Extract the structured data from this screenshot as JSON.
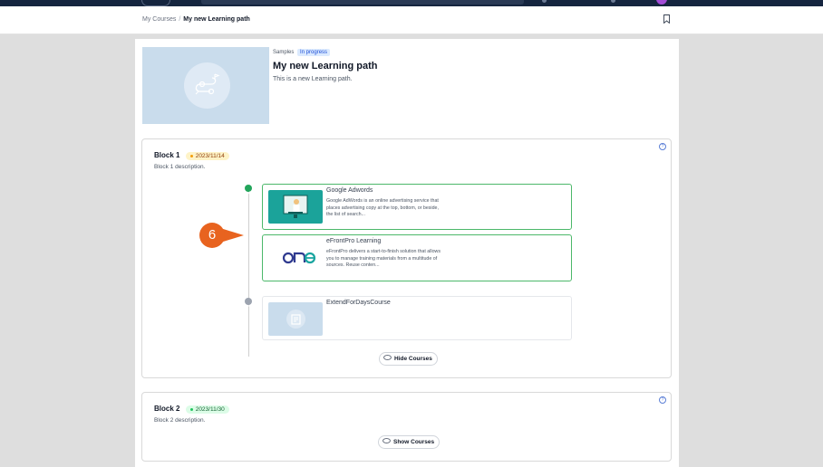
{
  "breadcrumb": {
    "parent": "My Courses",
    "separator": "/",
    "current": "My new Learning path"
  },
  "path": {
    "tag_category": "Samples",
    "tag_status": "In progress",
    "title": "My new Learning path",
    "description": "This is a new Learning path."
  },
  "blocks": [
    {
      "name": "Block 1",
      "date": "2023/11/14",
      "description": "Block 1 description.",
      "courses": [
        {
          "title": "Google Adwords",
          "description": "Google AdWords is an online advertising service that places advertising copy at the top, bottom, or beside, the list of search...",
          "status": "completed"
        },
        {
          "title": "eFrontPro Learning",
          "description": "eFrontPro delivers a start-to-finish solution that allows you to manage training materials from a multitude of sources. Reuse conten...",
          "status": "completed"
        },
        {
          "title": "ExtendForDaysCourse",
          "description": "",
          "status": "pending"
        }
      ],
      "toggle_label": "Hide Courses"
    },
    {
      "name": "Block 2",
      "date": "2023/11/30",
      "description": "Block 2 description.",
      "toggle_label": "Show Courses"
    }
  ],
  "step_marker": "6",
  "colors": {
    "accent_orange": "#e8631f",
    "success_green": "#22a55b",
    "navbar": "#15253f"
  }
}
